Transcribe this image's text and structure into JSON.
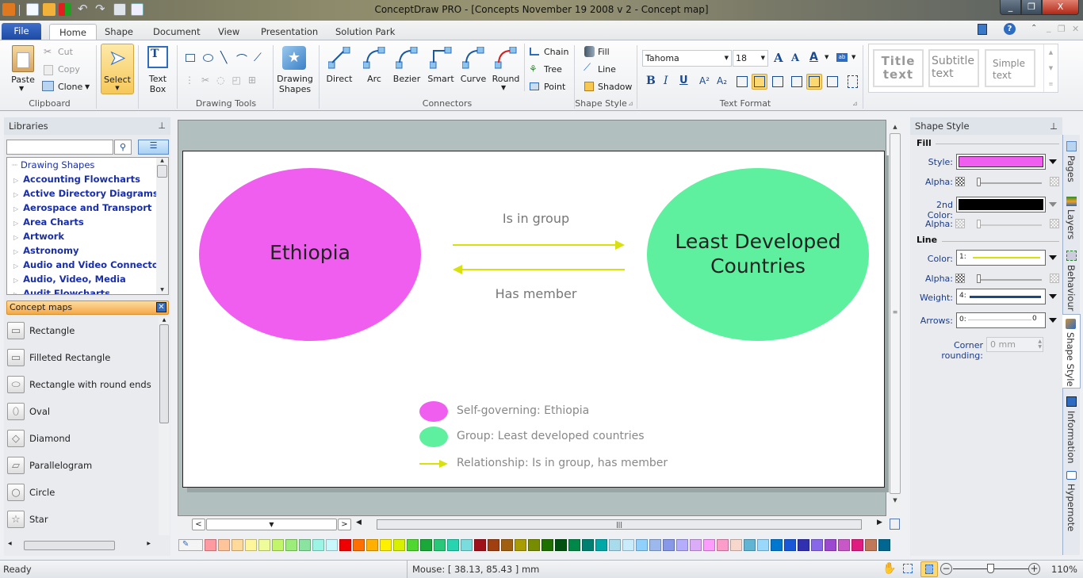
{
  "window": {
    "title": "ConceptDraw PRO - [Concepts November 19 2008 v 2 - Concept map]",
    "controls": {
      "minimize": "_",
      "restore": "❐",
      "close": "X"
    }
  },
  "quick_access": [
    "app-icon",
    "new-icon",
    "open-icon",
    "solution-icon",
    "undo-icon",
    "redo-icon",
    "save-icon",
    "print-preview-icon"
  ],
  "tabs": {
    "file": "File",
    "items": [
      "Home",
      "Shape",
      "Document",
      "View",
      "Presentation",
      "Solution Park"
    ],
    "active": "Home"
  },
  "ribbon": {
    "clipboard": {
      "paste": "Paste",
      "cut": "Cut",
      "copy": "Copy",
      "clone": "Clone",
      "label": "Clipboard"
    },
    "select": {
      "label": "Select"
    },
    "textbox": {
      "line1": "Text",
      "line2": "Box"
    },
    "drawing_tools": {
      "label": "Drawing Tools"
    },
    "drawing_shapes": {
      "line1": "Drawing",
      "line2": "Shapes"
    },
    "connectors": {
      "items": [
        "Direct",
        "Arc",
        "Bezier",
        "Smart",
        "Curve",
        "Round"
      ],
      "chain": "Chain",
      "tree": "Tree",
      "point": "Point",
      "label": "Connectors"
    },
    "shape_style": {
      "fill": "Fill",
      "line": "Line",
      "shadow": "Shadow",
      "label": "Shape Style"
    },
    "text_format": {
      "font": "Tahoma",
      "size": "18",
      "label": "Text Format"
    },
    "styles": {
      "title": "Title text",
      "subtitle": "Subtitle text",
      "simple": "Simple text"
    }
  },
  "libraries": {
    "title": "Libraries",
    "search_placeholder": "",
    "tree": [
      {
        "label": "Drawing Shapes",
        "root": true
      },
      {
        "label": "Accounting Flowcharts"
      },
      {
        "label": "Active Directory Diagrams"
      },
      {
        "label": "Aerospace and Transport"
      },
      {
        "label": "Area Charts"
      },
      {
        "label": "Artwork"
      },
      {
        "label": "Astronomy"
      },
      {
        "label": "Audio and Video Connectors"
      },
      {
        "label": "Audio, Video, Media"
      },
      {
        "label": "Audit Flowcharts"
      }
    ],
    "open_library": "Concept maps",
    "shapes": [
      "Rectangle",
      "Filleted Rectangle",
      "Rectangle with round ends",
      "Oval",
      "Diamond",
      "Parallelogram",
      "Circle",
      "Star"
    ]
  },
  "diagram": {
    "node1": {
      "label": "Ethiopia",
      "color": "#f05ef0"
    },
    "node2": {
      "label1": "Least Developed",
      "label2": "Countries",
      "color": "#5ef09e"
    },
    "edge_top": "Is in group",
    "edge_bottom": "Has member",
    "arrow_color": "#d8e010",
    "legend": [
      {
        "text": "Self-governing: Ethiopia",
        "color": "#f05ef0"
      },
      {
        "text": "Group: Least developed countries",
        "color": "#5ef09e"
      },
      {
        "text": "Relationship: Is in group, has member",
        "color": "#d8e010"
      }
    ]
  },
  "shape_style_panel": {
    "title": "Shape Style",
    "fill_section": "Fill",
    "style_label": "Style:",
    "style_color": "#f05ef0",
    "alpha_label": "Alpha:",
    "second_color_label": "2nd Color:",
    "second_color": "#000000",
    "line_section": "Line",
    "color_label": "Color:",
    "color_value": "1:",
    "line_color": "#d8e010",
    "weight_label": "Weight:",
    "weight_value": "4:",
    "arrows_label": "Arrows:",
    "arrows_value": "0:",
    "arrows_end": "0",
    "corner_label": "Corner rounding:",
    "corner_value": "0 mm"
  },
  "side_tabs": [
    "Pages",
    "Layers",
    "Behaviour",
    "Shape Style",
    "Information",
    "Hypernote"
  ],
  "palette": [
    "#ff9aa0",
    "#ffc49a",
    "#ffd99a",
    "#fff59a",
    "#eefc9a",
    "#c2f56a",
    "#9cec7a",
    "#8ae4a0",
    "#9cf5e4",
    "#c8f8fc",
    "#f00000",
    "#ff7000",
    "#ffb000",
    "#fff000",
    "#d8f000",
    "#50d830",
    "#1aa838",
    "#28c878",
    "#28d4b0",
    "#7adcdc",
    "#a01018",
    "#a04010",
    "#a06010",
    "#a89c00",
    "#788c00",
    "#207000",
    "#005010",
    "#008848",
    "#008070",
    "#00a8a8",
    "#a8dcec",
    "#c8ecfc",
    "#90d0fc",
    "#9cb8ec",
    "#8898e8",
    "#b4acfc",
    "#dcacf8",
    "#fc9cfc",
    "#fc9cc8",
    "#f8d8cc",
    "#60b4d4",
    "#98d8fc",
    "#0078d0",
    "#1858d8",
    "#3030b0",
    "#8868e8",
    "#9c48d0",
    "#c858c8",
    "#e01c80",
    "#c07858",
    "#006890"
  ],
  "status": {
    "ready": "Ready",
    "mouse": "Mouse: [ 38.13, 85.43 ] mm",
    "zoom": "110%",
    "zoom_fraction": 0.5
  }
}
